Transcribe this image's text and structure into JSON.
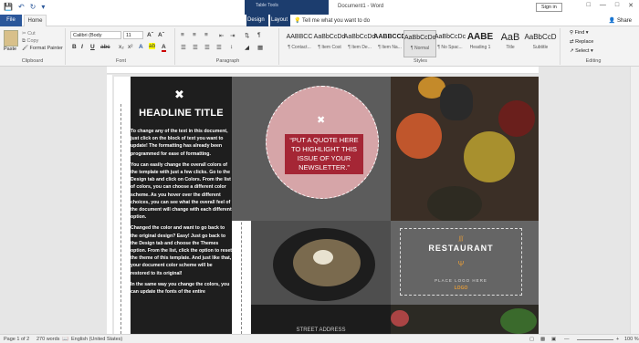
{
  "titlebar": {
    "context_group": "Table Tools",
    "doc_title": "Document1  -  Word",
    "signin": "Sign in"
  },
  "tabs": {
    "file": "File",
    "home": "Home",
    "design": "Design",
    "layout": "Layout",
    "tellme": "Tell me what you want to do",
    "share": "Share"
  },
  "clipboard": {
    "paste": "Paste",
    "cut": "Cut",
    "copy": "Copy",
    "format_painter": "Format Painter",
    "label": "Clipboard"
  },
  "font": {
    "name": "Calibri (Body",
    "size": "11",
    "bold": "B",
    "italic": "I",
    "underline": "U",
    "label": "Font"
  },
  "paragraph": {
    "label": "Paragraph"
  },
  "styles": {
    "label": "Styles",
    "items": [
      {
        "preview": "AABBCC",
        "name": "¶ Contact..."
      },
      {
        "preview": "AaBbCcDd",
        "name": "¶ Item Cost"
      },
      {
        "preview": "AaBbCcDd",
        "name": "¶ Item De..."
      },
      {
        "preview": "AABBCCD",
        "name": "¶ Item Na..."
      },
      {
        "preview": "AaBbCcDc",
        "name": "¶ Normal"
      },
      {
        "preview": "AaBbCcDc",
        "name": "¶ No Spac..."
      },
      {
        "preview": "AABE",
        "name": "Heading 1"
      },
      {
        "preview": "AaB",
        "name": "Title"
      },
      {
        "preview": "AaBbCcD",
        "name": "Subtitle"
      }
    ]
  },
  "editing": {
    "find": "Find",
    "replace": "Replace",
    "select": "Select",
    "label": "Editing"
  },
  "doc": {
    "headline": "HEADLINE TITLE",
    "paragraphs": [
      "To change any of the text in this document, just click on the block of text you want to update!  The formatting has already been programmed for ease of formatting.",
      "You can easily change the overall colors of the template with just a few clicks.  Go to the Design tab and click on Colors.  From the list of colors, you can choose a different color scheme.  As you hover over the different choices, you can see what the overall feel of the document will change with each different option.",
      "Changed the color and want to go back to the original design?  Easy!  Just go back to the Design tab and choose the Themes option.  From the list, click the option to reset the theme of this template.  And just like that, your document color scheme will be restored to its original!",
      "In the same way you change the colors, you can update the fonts of the entire"
    ],
    "quote": "“PUT A QUOTE HERE TO HIGHLIGHT THIS ISSUE OF YOUR NEWSLETTER.”",
    "restaurant": "RESTAURANT",
    "place_logo": "PLACE LOGO HERE",
    "logo_word": "LOGO",
    "street": "STREET ADDRESS"
  },
  "status": {
    "page": "Page 1 of 2",
    "words": "270 words",
    "lang": "English (United States)",
    "zoom": "100 %"
  }
}
